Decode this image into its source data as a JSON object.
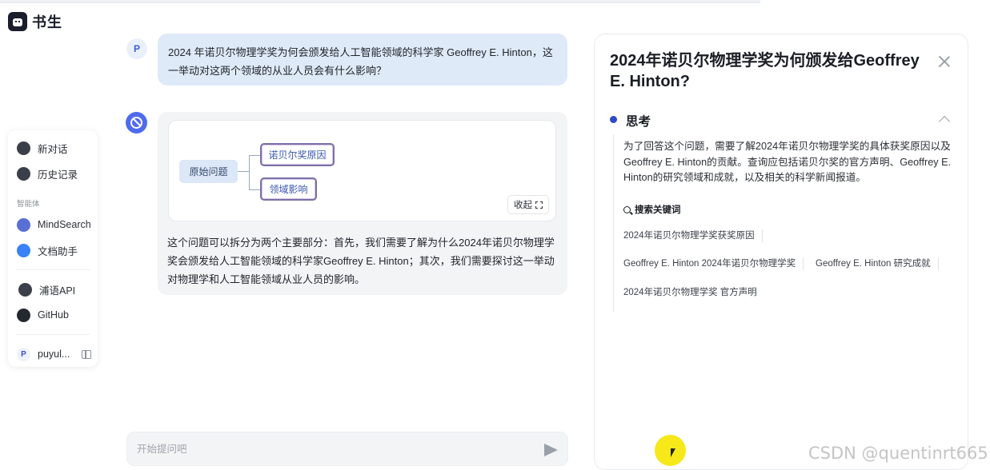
{
  "app": {
    "logo_text": "书生"
  },
  "sidebar": {
    "items": [
      {
        "label": "新对话",
        "icon": "new-chat-icon"
      },
      {
        "label": "历史记录",
        "icon": "history-icon"
      }
    ],
    "section_label": "智能体",
    "agents": [
      {
        "label": "MindSearch",
        "icon": "mindsearch-icon"
      },
      {
        "label": "文档助手",
        "icon": "doc-assistant-icon"
      }
    ],
    "links": [
      {
        "label": "浦语API",
        "icon": "api-icon"
      },
      {
        "label": "GitHub",
        "icon": "github-icon"
      }
    ],
    "user": {
      "avatar": "P",
      "name": "puyul..."
    }
  },
  "chat": {
    "user_avatar": "P",
    "user_message": "2024 年诺贝尔物理学奖为何会颁发给人工智能领域的科学家 Geoffrey E. Hinton，这一举动对这两个领域的从业人员会有什么影响？",
    "graph": {
      "root": "原始问题",
      "children": [
        "诺贝尔奖原因",
        "领域影响"
      ],
      "collapse_label": "收起"
    },
    "bot_message": "这个问题可以拆分为两个主要部分：首先，我们需要了解为什么2024年诺贝尔物理学奖会颁发给人工智能领域的科学家Geoffrey E. Hinton；其次，我们需要探讨这一举动对物理学和人工智能领域从业人员的影响。"
  },
  "input": {
    "placeholder": "开始提问吧",
    "value": ""
  },
  "panel": {
    "title": "2024年诺贝尔物理学奖为何颁发给Geoffrey E. Hinton?",
    "section_title": "思考",
    "thinking_text": "为了回答这个问题，需要了解2024年诺贝尔物理学奖的具体获奖原因以及Geoffrey E. Hinton的贡献。查询应包括诺贝尔奖的官方声明、Geoffrey E. Hinton的研究领域和成就，以及相关的科学新闻报道。",
    "keywords_label": "搜索关键词",
    "keywords": [
      "2024年诺贝尔物理学奖获奖原因",
      "Geoffrey E. Hinton 2024年诺贝尔物理学奖",
      "Geoffrey E. Hinton 研究成就",
      "2024年诺贝尔物理学奖 官方声明"
    ]
  },
  "watermark": "CSDN @quentinrt665",
  "colors": {
    "accent": "#2b4acb",
    "user_bubble": "#dfeaf8",
    "bot_bubble": "#f3f4f6",
    "cursor_highlight": "#f5e600"
  }
}
